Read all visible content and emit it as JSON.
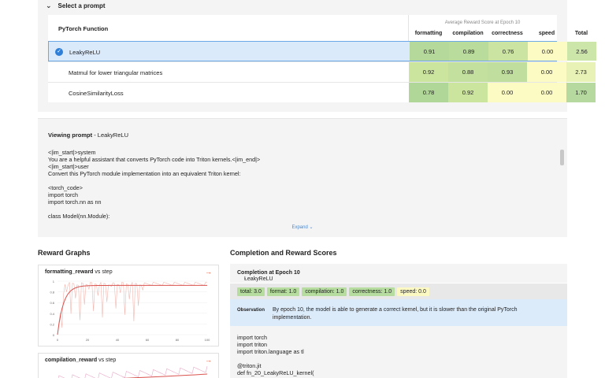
{
  "selector": {
    "title": "Select a prompt",
    "column_group": "Average Reward Score at Epoch 10",
    "fn_header": "PyTorch Function",
    "columns": [
      "formatting",
      "compilation",
      "correctness",
      "speed",
      "Total"
    ],
    "rows": [
      {
        "name": "LeakyReLU",
        "values": [
          "0.91",
          "0.89",
          "0.76",
          "0.00",
          "2.56"
        ],
        "selected": true
      },
      {
        "name": "Matmul for lower triangular matrices",
        "values": [
          "0.92",
          "0.88",
          "0.93",
          "0.00",
          "2.73"
        ],
        "selected": false
      },
      {
        "name": "CosineSimilarityLoss",
        "values": [
          "0.78",
          "0.92",
          "0.00",
          "0.00",
          "1.70"
        ],
        "selected": false
      }
    ],
    "colors": {
      "0.91": "#b4d99a",
      "0.89": "#b9dc9d",
      "0.76": "#cbe4a2",
      "0.00": "#fdfbc4",
      "2.56": "#cce6a9",
      "0.92": "#cbe59e",
      "0.88": "#c4e09f",
      "0.93": "#c0de9e",
      "2.73": "#e9f2b6",
      "0.78": "#b0d797",
      "1.70": "#b5d99f"
    }
  },
  "viewing": {
    "label": "Viewing prompt",
    "sep": " - ",
    "name": "LeakyReLU",
    "body": "<|im_start|>system\nYou are a helpful assistant that converts PyTorch code into Triton kernels.<|im_end|>\n<|im_start|>user\nConvert this PyTorch module implementation into an equivalent Triton kernel:\n\n<torch_code>\nimport torch\nimport torch.nn as nn\n\nclass Model(nn.Module):",
    "expand": "Expand ⌄"
  },
  "reward_graphs": {
    "title": "Reward Graphs",
    "cards": [
      {
        "metric": "formatting_reward",
        "suffix": " vs step"
      },
      {
        "metric": "compilation_reward",
        "suffix": " vs step"
      }
    ],
    "y_ticks": [
      "1",
      "0.8",
      "0.6",
      "0.4",
      "0.2",
      "0"
    ],
    "x_ticks": [
      "0",
      "20",
      "40",
      "60",
      "80",
      "100"
    ]
  },
  "completion": {
    "title": "Completion and Reward Scores",
    "header_label": "Completion at Epoch 10",
    "header_sep": " - ",
    "header_name": "LeakyReLU",
    "badges": [
      {
        "text": "total: 3.0",
        "color": "#b6dca0"
      },
      {
        "text": "format: 1.0",
        "color": "#b6dca0"
      },
      {
        "text": "compilation: 1.0",
        "color": "#b6dca0"
      },
      {
        "text": "correctness: 1.0",
        "color": "#b6dca0"
      },
      {
        "text": "speed: 0.0",
        "color": "#fbf8c2"
      }
    ],
    "observation_label": "Observation",
    "observation_text": "By epoch 10, the model is able to generate a correct kernel, but it is slower than the original PyTorch implementation.",
    "code": "import torch\nimport triton\nimport triton.language as tl\n\n@triton.jit\ndef fn_20_LeakyReLU_kernel("
  }
}
